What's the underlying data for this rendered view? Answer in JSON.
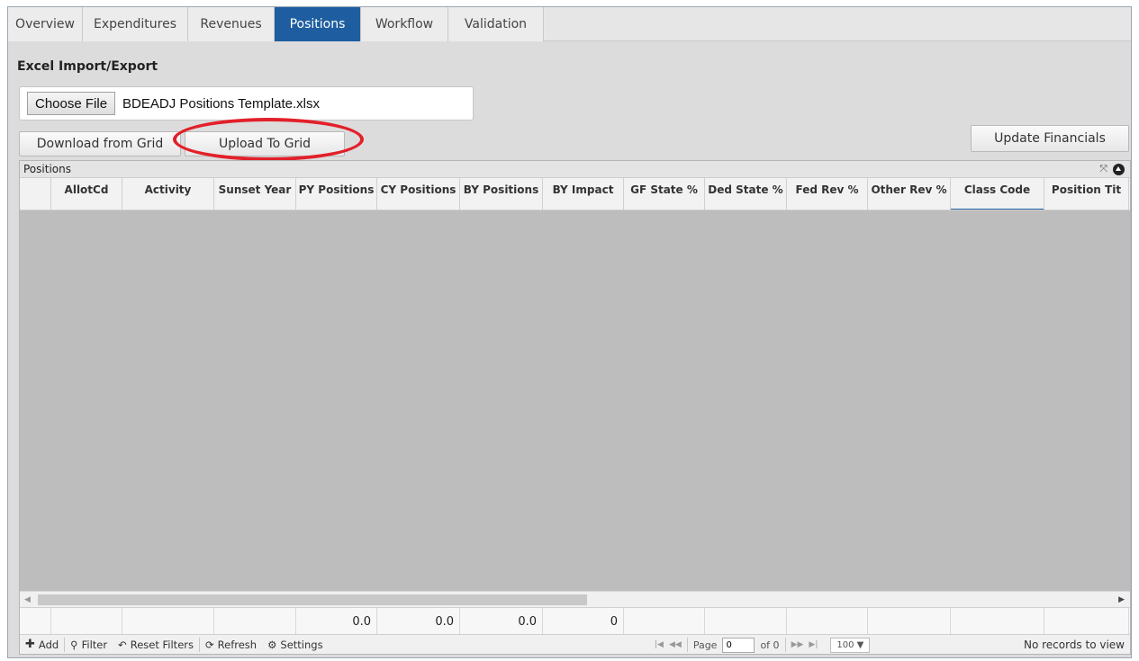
{
  "tabs": [
    {
      "label": "Overview",
      "active": false
    },
    {
      "label": "Expenditures",
      "active": false
    },
    {
      "label": "Revenues",
      "active": false
    },
    {
      "label": "Positions",
      "active": true
    },
    {
      "label": "Workflow",
      "active": false
    },
    {
      "label": "Validation",
      "active": false
    }
  ],
  "excel": {
    "title": "Excel Import/Export",
    "choose_file_label": "Choose File",
    "file_name": "BDEADJ Positions Template.xlsx",
    "download_label": "Download from Grid",
    "upload_label": "Upload To Grid",
    "update_financials_label": "Update Financials"
  },
  "grid": {
    "caption": "Positions",
    "columns": [
      "",
      "AllotCd",
      "Activity",
      "Sunset Year",
      "PY Positions",
      "CY Positions",
      "BY Positions",
      "BY Impact",
      "GF State %",
      "Ded State %",
      "Fed Rev %",
      "Other Rev %",
      "Class Code",
      "Position Tit"
    ],
    "active_column": "Class Code",
    "footer_values": [
      "",
      "",
      "",
      "",
      "0.0",
      "0.0",
      "0.0",
      "0",
      "",
      "",
      "",
      "",
      "",
      ""
    ]
  },
  "toolbar": {
    "add": "Add",
    "filter": "Filter",
    "reset_filters": "Reset Filters",
    "refresh": "Refresh",
    "settings": "Settings",
    "page_label": "Page",
    "page_value": "0",
    "of_label": "of 0",
    "page_size": "100 ▼",
    "records_text": "No records to view"
  },
  "colors": {
    "accent": "#1e5ea0",
    "annotation": "#e2202a",
    "grid_body": "#bdbdbd"
  }
}
